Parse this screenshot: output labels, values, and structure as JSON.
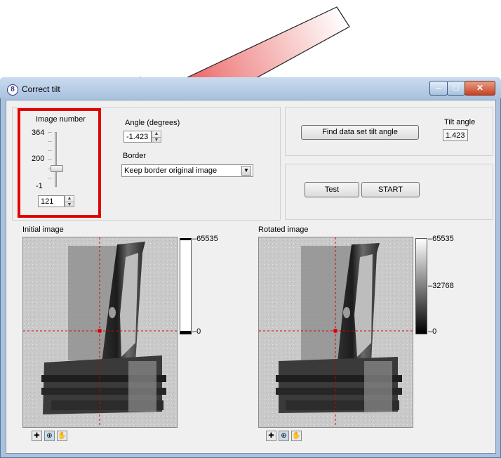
{
  "window": {
    "title": "Correct tilt",
    "app_icon_glyph": "8"
  },
  "image_number": {
    "label": "Image number",
    "max": "364",
    "mid": "200",
    "min": "-1",
    "value": "121",
    "slider_fraction": 0.33
  },
  "angle": {
    "label": "Angle (degrees)",
    "value": "-1.423"
  },
  "border": {
    "label": "Border",
    "selected": "Keep border original image"
  },
  "tilt": {
    "find_button": "Find data set tilt angle",
    "label": "Tilt angle",
    "value": "1.423"
  },
  "actions": {
    "test_button": "Test",
    "start_button": "START"
  },
  "initial_image": {
    "label": "Initial image",
    "scale_max": "65535",
    "scale_min": "0"
  },
  "rotated_image": {
    "label": "Rotated image",
    "scale_max": "65535",
    "scale_mid": "32768",
    "scale_min": "0"
  },
  "colors": {
    "highlight_box": "#e30000",
    "arrow": "#e30000",
    "crosshair": "#d40000"
  },
  "icons": [
    "crosshair-icon",
    "zoom-icon",
    "pan-hand-icon",
    "minimize-icon",
    "maximize-icon",
    "close-icon",
    "spin-up-icon",
    "spin-down-icon",
    "dropdown-arrow-icon"
  ]
}
